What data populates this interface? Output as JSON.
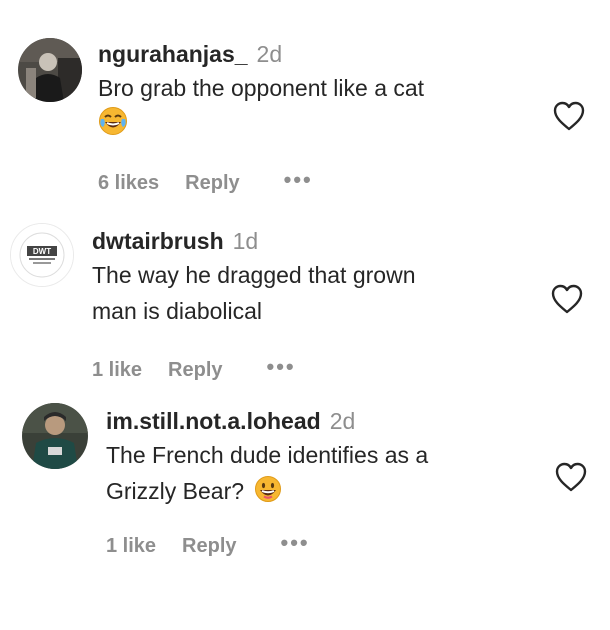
{
  "comments": [
    {
      "username": "ngurahanjas_",
      "time": "2d",
      "text": "Bro grab the opponent like a cat",
      "emoji": "laughing-tears-emoji",
      "likes": "6 likes",
      "reply": "Reply",
      "more": "•••"
    },
    {
      "username": "dwtairbrush",
      "time": "1d",
      "text_line1": "The way he dragged that grown",
      "text_line2": "man is diabolical",
      "likes": "1 like",
      "reply": "Reply",
      "more": "•••"
    },
    {
      "username": "im.still.not.a.lohead",
      "time": "2d",
      "text_line1": "The French dude identifies as a",
      "text_line2": "Grizzly Bear?",
      "emoji": "grinning-emoji",
      "likes": "1 like",
      "reply": "Reply",
      "more": "•••"
    }
  ],
  "colors": {
    "text": "#262626",
    "secondary": "#8e8e8e",
    "emoji": "#f7b731"
  },
  "avatar_logo_text": "DWT"
}
